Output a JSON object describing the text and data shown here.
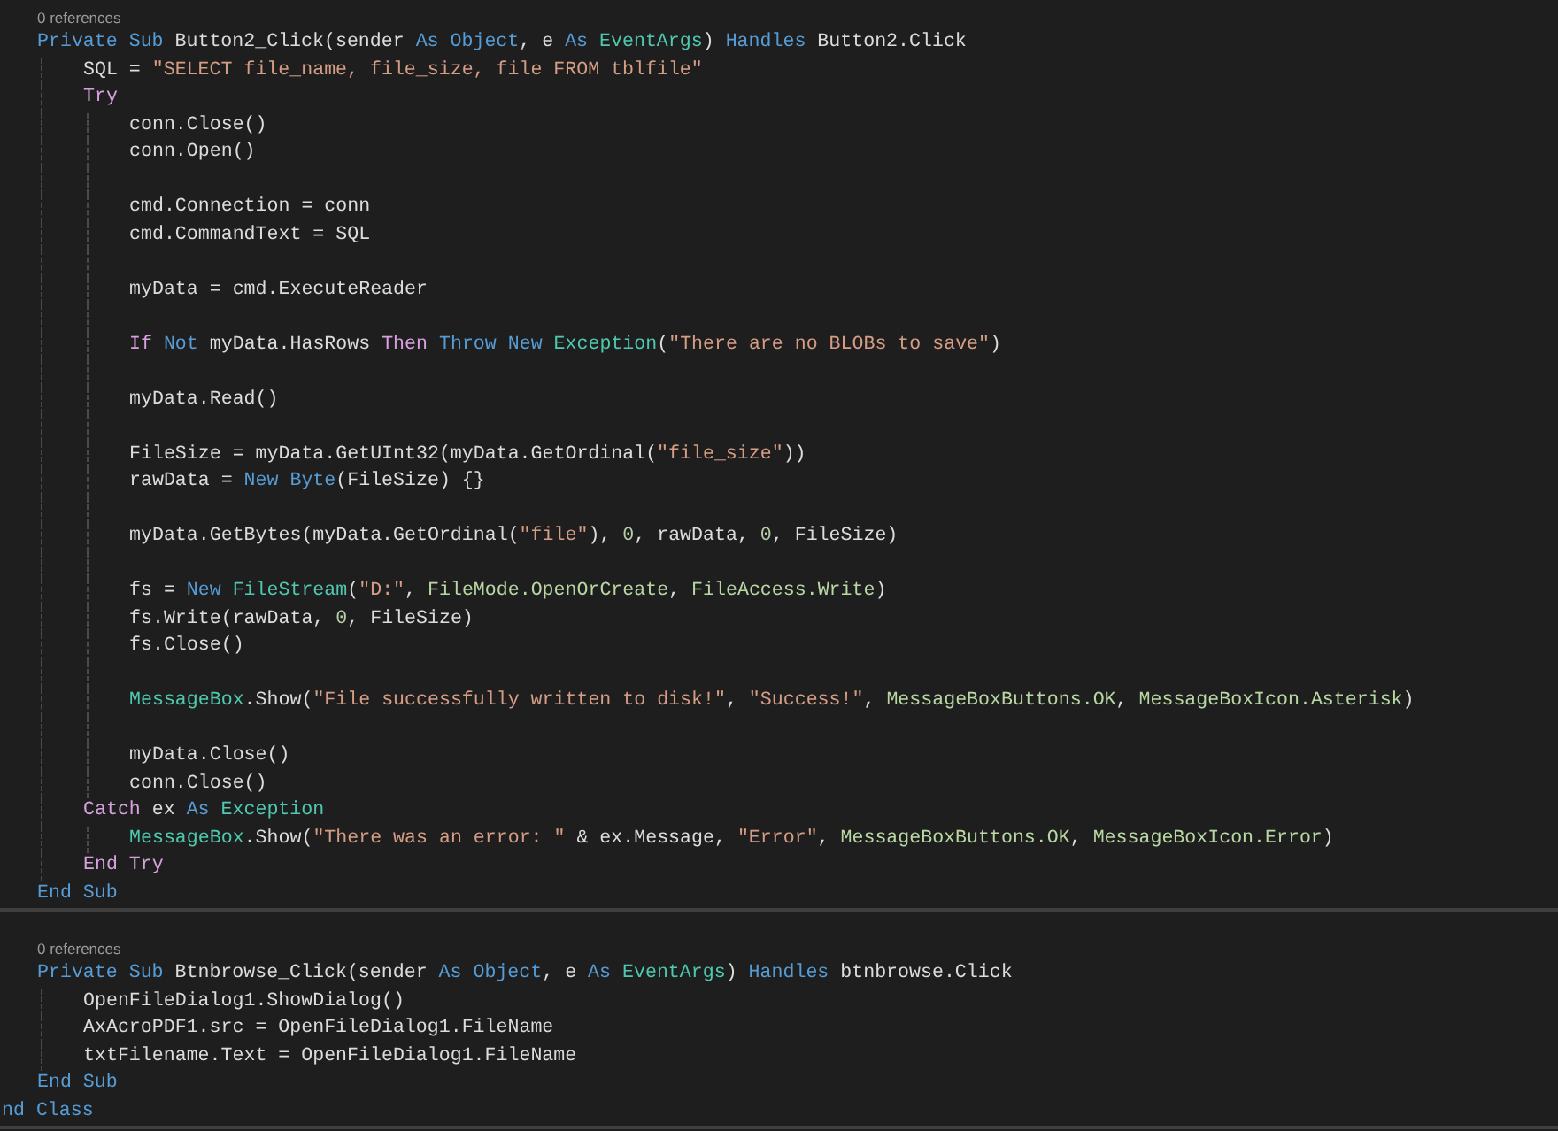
{
  "blocks": [
    {
      "codelens": "0 references",
      "lines": [
        {
          "kind": "code",
          "tokens": [
            {
              "kind": "keyword",
              "text": "Private Sub"
            },
            {
              "kind": "plain",
              "text": " Button2_Click(sender "
            },
            {
              "kind": "keyword",
              "text": "As Object"
            },
            {
              "kind": "plain",
              "text": ", e "
            },
            {
              "kind": "keyword",
              "text": "As "
            },
            {
              "kind": "type",
              "text": "EventArgs"
            },
            {
              "kind": "plain",
              "text": ") "
            },
            {
              "kind": "keyword",
              "text": "Handles"
            },
            {
              "kind": "plain",
              "text": " Button2.Click"
            }
          ],
          "children": [
            {
              "kind": "code",
              "tokens": [
                {
                  "kind": "plain",
                  "text": "SQL = "
                },
                {
                  "kind": "string",
                  "text": "\"SELECT file_name, file_size, file FROM tblfile\""
                }
              ]
            },
            {
              "kind": "code",
              "tokens": [
                {
                  "kind": "control",
                  "text": "Try"
                }
              ],
              "children": [
                {
                  "kind": "code",
                  "tokens": [
                    {
                      "kind": "plain",
                      "text": "conn.Close()"
                    }
                  ]
                },
                {
                  "kind": "code",
                  "tokens": [
                    {
                      "kind": "plain",
                      "text": "conn.Open()"
                    }
                  ]
                },
                {
                  "kind": "blank"
                },
                {
                  "kind": "code",
                  "tokens": [
                    {
                      "kind": "plain",
                      "text": "cmd.Connection = conn"
                    }
                  ]
                },
                {
                  "kind": "code",
                  "tokens": [
                    {
                      "kind": "plain",
                      "text": "cmd.CommandText = SQL"
                    }
                  ]
                },
                {
                  "kind": "blank"
                },
                {
                  "kind": "code",
                  "tokens": [
                    {
                      "kind": "plain",
                      "text": "myData = cmd.ExecuteReader"
                    }
                  ]
                },
                {
                  "kind": "blank"
                },
                {
                  "kind": "code",
                  "tokens": [
                    {
                      "kind": "control",
                      "text": "If "
                    },
                    {
                      "kind": "keyword",
                      "text": "Not"
                    },
                    {
                      "kind": "plain",
                      "text": " myData.HasRows "
                    },
                    {
                      "kind": "control",
                      "text": "Then "
                    },
                    {
                      "kind": "keyword",
                      "text": "Throw New "
                    },
                    {
                      "kind": "type",
                      "text": "Exception"
                    },
                    {
                      "kind": "plain",
                      "text": "("
                    },
                    {
                      "kind": "string",
                      "text": "\"There are no BLOBs to save\""
                    },
                    {
                      "kind": "plain",
                      "text": ")"
                    }
                  ]
                },
                {
                  "kind": "blank"
                },
                {
                  "kind": "code",
                  "tokens": [
                    {
                      "kind": "plain",
                      "text": "myData.Read()"
                    }
                  ]
                },
                {
                  "kind": "blank"
                },
                {
                  "kind": "code",
                  "tokens": [
                    {
                      "kind": "plain",
                      "text": "FileSize = myData.GetUInt32(myData.GetOrdinal("
                    },
                    {
                      "kind": "string",
                      "text": "\"file_size\""
                    },
                    {
                      "kind": "plain",
                      "text": "))"
                    }
                  ]
                },
                {
                  "kind": "code",
                  "tokens": [
                    {
                      "kind": "plain",
                      "text": "rawData = "
                    },
                    {
                      "kind": "keyword",
                      "text": "New Byte"
                    },
                    {
                      "kind": "plain",
                      "text": "(FileSize) {}"
                    }
                  ]
                },
                {
                  "kind": "blank"
                },
                {
                  "kind": "code",
                  "tokens": [
                    {
                      "kind": "plain",
                      "text": "myData.GetBytes(myData.GetOrdinal("
                    },
                    {
                      "kind": "string",
                      "text": "\"file\""
                    },
                    {
                      "kind": "plain",
                      "text": "), "
                    },
                    {
                      "kind": "number",
                      "text": "0"
                    },
                    {
                      "kind": "plain",
                      "text": ", rawData, "
                    },
                    {
                      "kind": "number",
                      "text": "0"
                    },
                    {
                      "kind": "plain",
                      "text": ", FileSize)"
                    }
                  ]
                },
                {
                  "kind": "blank"
                },
                {
                  "kind": "code",
                  "tokens": [
                    {
                      "kind": "plain",
                      "text": "fs = "
                    },
                    {
                      "kind": "keyword",
                      "text": "New "
                    },
                    {
                      "kind": "type",
                      "text": "FileStream"
                    },
                    {
                      "kind": "plain",
                      "text": "("
                    },
                    {
                      "kind": "string",
                      "text": "\"D:\""
                    },
                    {
                      "kind": "plain",
                      "text": ", "
                    },
                    {
                      "kind": "enum",
                      "text": "FileMode.OpenOrCreate"
                    },
                    {
                      "kind": "plain",
                      "text": ", "
                    },
                    {
                      "kind": "enum",
                      "text": "FileAccess.Write"
                    },
                    {
                      "kind": "plain",
                      "text": ")"
                    }
                  ]
                },
                {
                  "kind": "code",
                  "tokens": [
                    {
                      "kind": "plain",
                      "text": "fs.Write(rawData, "
                    },
                    {
                      "kind": "number",
                      "text": "0"
                    },
                    {
                      "kind": "plain",
                      "text": ", FileSize)"
                    }
                  ]
                },
                {
                  "kind": "code",
                  "tokens": [
                    {
                      "kind": "plain",
                      "text": "fs.Close()"
                    }
                  ]
                },
                {
                  "kind": "blank"
                },
                {
                  "kind": "code",
                  "tokens": [
                    {
                      "kind": "type",
                      "text": "MessageBox"
                    },
                    {
                      "kind": "plain",
                      "text": ".Show("
                    },
                    {
                      "kind": "string",
                      "text": "\"File successfully written to disk!\""
                    },
                    {
                      "kind": "plain",
                      "text": ", "
                    },
                    {
                      "kind": "string",
                      "text": "\"Success!\""
                    },
                    {
                      "kind": "plain",
                      "text": ", "
                    },
                    {
                      "kind": "enum",
                      "text": "MessageBoxButtons.OK"
                    },
                    {
                      "kind": "plain",
                      "text": ", "
                    },
                    {
                      "kind": "enum",
                      "text": "MessageBoxIcon.Asterisk"
                    },
                    {
                      "kind": "plain",
                      "text": ")"
                    }
                  ]
                },
                {
                  "kind": "blank"
                },
                {
                  "kind": "code",
                  "tokens": [
                    {
                      "kind": "plain",
                      "text": "myData.Close()"
                    }
                  ]
                },
                {
                  "kind": "code",
                  "tokens": [
                    {
                      "kind": "plain",
                      "text": "conn.Close()"
                    }
                  ]
                }
              ]
            },
            {
              "kind": "code",
              "tokens": [
                {
                  "kind": "control",
                  "text": "Catch"
                },
                {
                  "kind": "plain",
                  "text": " ex "
                },
                {
                  "kind": "keyword",
                  "text": "As "
                },
                {
                  "kind": "type",
                  "text": "Exception"
                }
              ],
              "children": [
                {
                  "kind": "code",
                  "tokens": [
                    {
                      "kind": "type",
                      "text": "MessageBox"
                    },
                    {
                      "kind": "plain",
                      "text": ".Show("
                    },
                    {
                      "kind": "string",
                      "text": "\"There was an error: \""
                    },
                    {
                      "kind": "plain",
                      "text": " & ex.Message, "
                    },
                    {
                      "kind": "string",
                      "text": "\"Error\""
                    },
                    {
                      "kind": "plain",
                      "text": ", "
                    },
                    {
                      "kind": "enum",
                      "text": "MessageBoxButtons.OK"
                    },
                    {
                      "kind": "plain",
                      "text": ", "
                    },
                    {
                      "kind": "enum",
                      "text": "MessageBoxIcon.Error"
                    },
                    {
                      "kind": "plain",
                      "text": ")"
                    }
                  ]
                }
              ]
            },
            {
              "kind": "code",
              "tokens": [
                {
                  "kind": "control",
                  "text": "End Try"
                }
              ]
            }
          ]
        },
        {
          "kind": "code",
          "tokens": [
            {
              "kind": "keyword",
              "text": "End Sub"
            }
          ]
        }
      ]
    },
    {
      "codelens": "0 references",
      "lines": [
        {
          "kind": "code",
          "tokens": [
            {
              "kind": "keyword",
              "text": "Private Sub"
            },
            {
              "kind": "plain",
              "text": " Btnbrowse_Click(sender "
            },
            {
              "kind": "keyword",
              "text": "As Object"
            },
            {
              "kind": "plain",
              "text": ", e "
            },
            {
              "kind": "keyword",
              "text": "As "
            },
            {
              "kind": "type",
              "text": "EventArgs"
            },
            {
              "kind": "plain",
              "text": ") "
            },
            {
              "kind": "keyword",
              "text": "Handles"
            },
            {
              "kind": "plain",
              "text": " btnbrowse.Click"
            }
          ],
          "children": [
            {
              "kind": "code",
              "tokens": [
                {
                  "kind": "plain",
                  "text": "OpenFileDialog1.ShowDialog()"
                }
              ]
            },
            {
              "kind": "code",
              "tokens": [
                {
                  "kind": "plain",
                  "text": "AxAcroPDF1.src = OpenFileDialog1.FileName"
                }
              ]
            },
            {
              "kind": "code",
              "tokens": [
                {
                  "kind": "plain",
                  "text": "txtFilename.Text = OpenFileDialog1.FileName"
                }
              ]
            }
          ]
        },
        {
          "kind": "code",
          "tokens": [
            {
              "kind": "keyword",
              "text": "End Sub"
            }
          ]
        }
      ],
      "cut_line": {
        "tokens": [
          {
            "kind": "keyword",
            "text": "nd Class"
          }
        ]
      }
    }
  ]
}
